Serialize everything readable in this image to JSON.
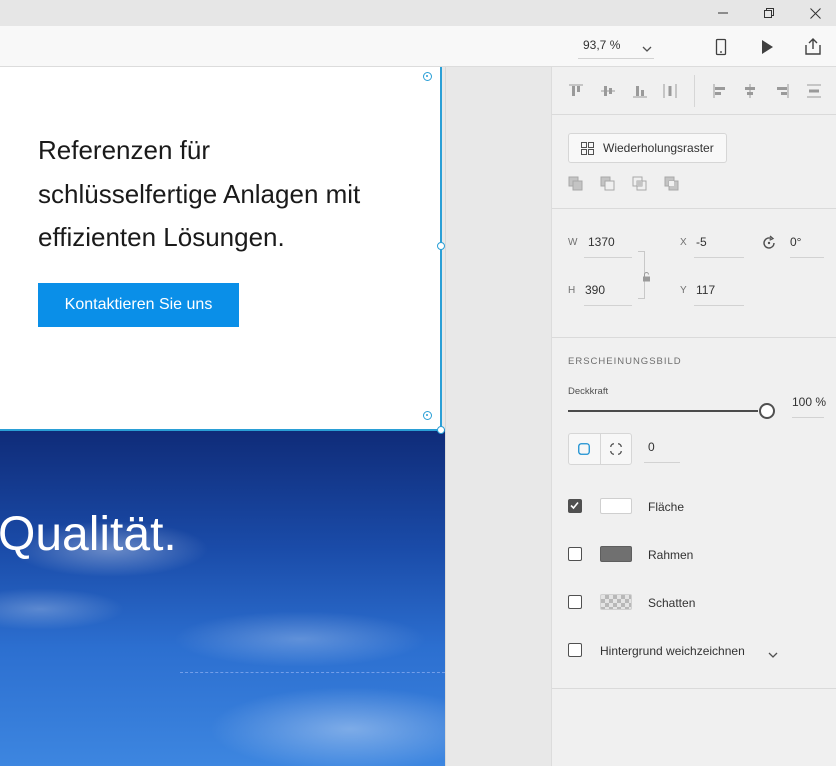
{
  "titlebar": {
    "minimize_icon": "minimize-icon",
    "restore_icon": "restore-icon",
    "close_icon": "close-icon"
  },
  "toolbar": {
    "zoom": "93,7 %",
    "icons": [
      "chevron-down-icon",
      "mobile-preview-icon",
      "play-icon",
      "share-icon"
    ]
  },
  "canvas": {
    "headline": "Referenzen für schlüsselfertige Anlagen mit effizienten Lösungen.",
    "cta_label": "Kontaktieren Sie uns",
    "hero_text": "Qualität.",
    "colors": {
      "cta": "#0a8fe8",
      "selection": "#2a9fd6",
      "sky_top": "#0f2b78",
      "sky_bottom": "#3d86e0"
    }
  },
  "panel": {
    "repeat_grid_label": "Wiederholungsraster",
    "transform": {
      "w_label": "W",
      "w_value": "1370",
      "h_label": "H",
      "h_value": "390",
      "x_label": "X",
      "x_value": "-5",
      "y_label": "Y",
      "y_value": "117",
      "rotation_value": "0°"
    },
    "appearance": {
      "section_title": "ERSCHEINUNGSBILD",
      "opacity_label": "Deckkraft",
      "opacity_value": "100 %",
      "opacity_fraction": 1.0,
      "corner_radius_value": "0",
      "fill_label": "Fläche",
      "fill_checked": true,
      "fill_color": "#ffffff",
      "border_label": "Rahmen",
      "border_checked": false,
      "border_color": "#707070",
      "shadow_label": "Schatten",
      "shadow_checked": false,
      "blur_label": "Hintergrund weichzeichnen",
      "blur_checked": false
    }
  }
}
